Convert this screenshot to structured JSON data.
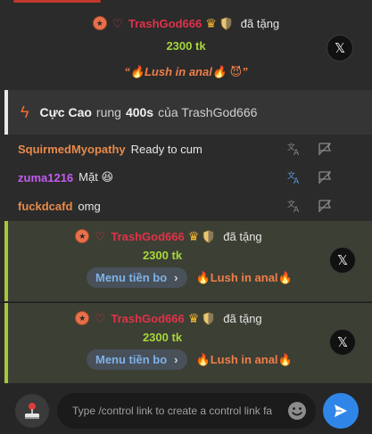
{
  "gift_top": {
    "username": "TrashGod666",
    "verb": "đã tặng",
    "amount": "2300 tk",
    "message": "“🔥Lush in anal🔥 😈”"
  },
  "tip_bar": {
    "level": "Cực Cao",
    "text_mid": "rung",
    "duration": "400s",
    "text_end": "của TrashGod666"
  },
  "chat": [
    {
      "user": "SquirmedMyopathy",
      "user_color": "#e88a4a",
      "message": "Ready to cum"
    },
    {
      "user": "zuma1216",
      "user_color": "#c45cf0",
      "message": "Mặt 😆"
    },
    {
      "user": "fuckdcafd",
      "user_color": "#e88a4a",
      "message": "omg"
    }
  ],
  "gift_cards": [
    {
      "username": "TrashGod666",
      "verb": "đã tặng",
      "amount": "2300 tk",
      "menu_label": "Menu tiền bo",
      "item": "🔥Lush in anal🔥"
    },
    {
      "username": "TrashGod666",
      "verb": "đã tặng",
      "amount": "2300 tk",
      "menu_label": "Menu tiền bo",
      "item": "🔥Lush in anal🔥"
    }
  ],
  "input": {
    "placeholder": "Type /control link to create a control link fa"
  },
  "colors": {
    "username_red": "#e0324b",
    "amount_green": "#a6d63d",
    "send_blue": "#2f86e8",
    "card_accent": "#a6c73c"
  },
  "icons": {
    "close": "x-logo-icon",
    "tip": "bolt-icon",
    "translate": "translate-icon",
    "hide": "flag-icon",
    "emoji": "smiley-icon",
    "send": "send-icon",
    "joystick": "joystick-icon"
  }
}
